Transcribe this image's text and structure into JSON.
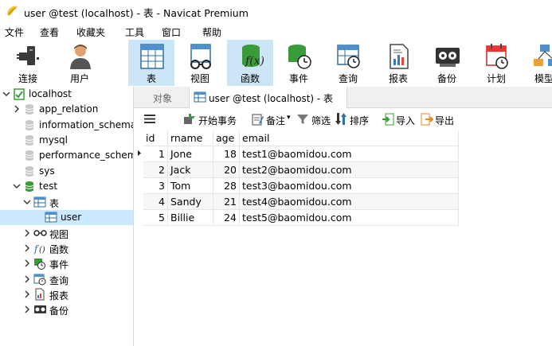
{
  "window": {
    "title": "user @test (localhost) - 表 - Navicat Premium"
  },
  "menu": [
    "文件",
    "查看",
    "收藏夹",
    "工具",
    "窗口",
    "帮助"
  ],
  "toolbar": {
    "buttons": [
      {
        "label": "连接",
        "icon": "plug-icon"
      },
      {
        "label": "用户",
        "icon": "user-icon"
      },
      {
        "label": "表",
        "icon": "table-icon"
      },
      {
        "label": "视图",
        "icon": "glasses-icon"
      },
      {
        "label": "函数",
        "icon": "function-icon"
      },
      {
        "label": "事件",
        "icon": "event-icon"
      },
      {
        "label": "查询",
        "icon": "query-icon"
      },
      {
        "label": "报表",
        "icon": "report-icon"
      },
      {
        "label": "备份",
        "icon": "backup-icon"
      },
      {
        "label": "计划",
        "icon": "schedule-icon"
      },
      {
        "label": "模型",
        "icon": "model-icon"
      }
    ]
  },
  "tree": {
    "connection": "localhost",
    "databases_top": [
      "app_relation",
      "information_schema",
      "mysql",
      "performance_schema",
      "sys"
    ],
    "open_db": "test",
    "tables_label": "表",
    "table_item": "user",
    "folders": [
      "视图",
      "函数",
      "事件",
      "查询",
      "报表",
      "备份"
    ]
  },
  "tabs": {
    "objects": "对象",
    "active": "user @test (localhost) - 表"
  },
  "objtoolbar": {
    "menu": "≡",
    "begin_transaction": "开始事务",
    "memo": "备注",
    "filter": "筛选",
    "sort": "排序",
    "import": "导入",
    "export": "导出"
  },
  "grid": {
    "columns": [
      "id",
      "rname",
      "age",
      "email"
    ],
    "rows": [
      [
        "1",
        "Jone",
        "18",
        "test1@baomidou.com"
      ],
      [
        "2",
        "Jack",
        "20",
        "test2@baomidou.com"
      ],
      [
        "3",
        "Tom",
        "28",
        "test3@baomidou.com"
      ],
      [
        "4",
        "Sandy",
        "21",
        "test4@baomidou.com"
      ],
      [
        "5",
        "Billie",
        "24",
        "test5@baomidou.com"
      ]
    ]
  }
}
